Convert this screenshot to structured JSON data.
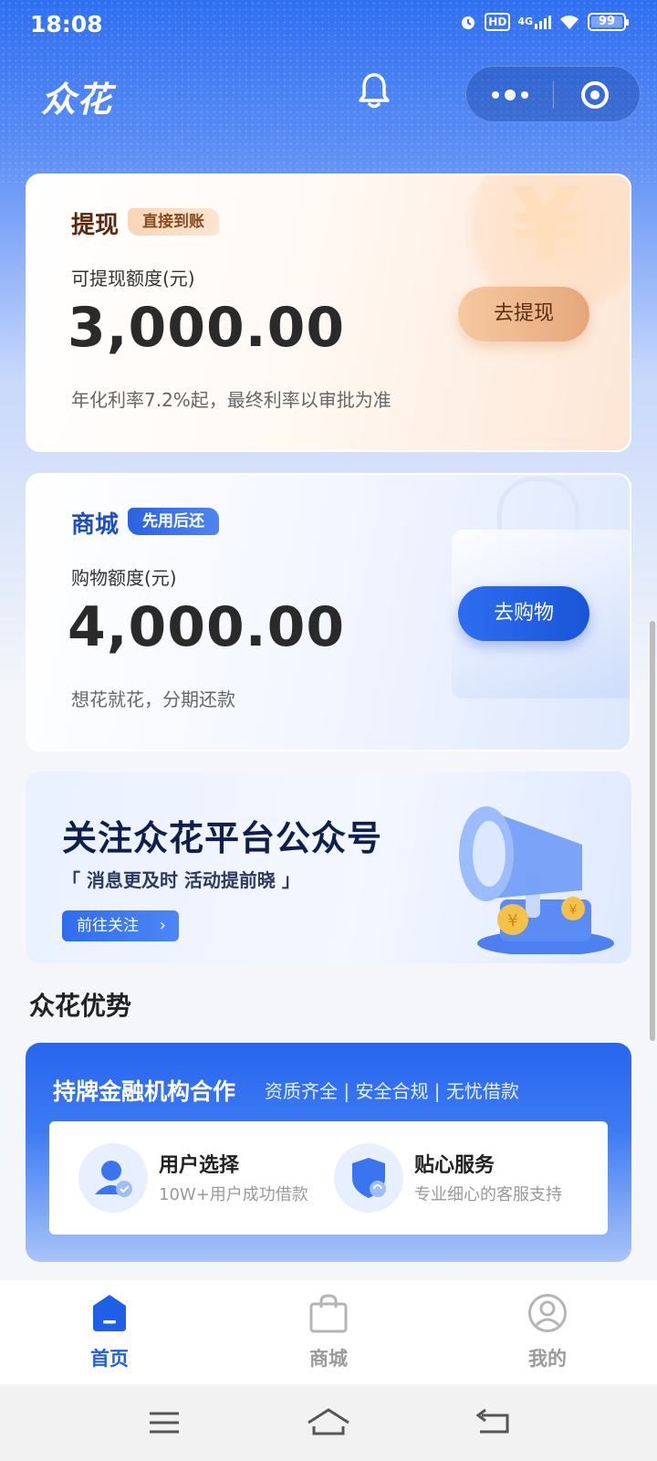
{
  "status_bar": {
    "time": "18:08",
    "hd": "HD",
    "network": "4G",
    "battery": "99"
  },
  "header": {
    "logo": "众花",
    "icons": [
      "bell-icon",
      "more-icon",
      "target-icon"
    ]
  },
  "withdraw_card": {
    "title": "提现",
    "tag": "直接到账",
    "label": "可提现额度(元)",
    "amount": "3,000.00",
    "note": "年化利率7.2%起，最终利率以审批为准",
    "button": "去提现"
  },
  "mall_card": {
    "title": "商城",
    "tag": "先用后还",
    "label": "购物额度(元)",
    "amount": "4,000.00",
    "note": "想花就花，分期还款",
    "button": "去购物"
  },
  "banner": {
    "title": "关注众花平台公众号",
    "subtitle": "「 消息更及时 活动提前晓 」",
    "button": "前往关注"
  },
  "advantages": {
    "section_title": "众花优势",
    "title": "持牌金融机构合作",
    "subtitle": "资质齐全 | 安全合规 | 无忧借款",
    "features": [
      {
        "title": "用户选择",
        "desc": "10W+用户成功借款",
        "icon": "user-check-icon"
      },
      {
        "title": "贴心服务",
        "desc": "专业细心的客服支持",
        "icon": "shield-service-icon"
      }
    ]
  },
  "tabbar": {
    "items": [
      {
        "label": "首页",
        "icon": "home-icon",
        "active": true
      },
      {
        "label": "商城",
        "icon": "shopping-bag-icon",
        "active": false
      },
      {
        "label": "我的",
        "icon": "profile-icon",
        "active": false
      }
    ]
  },
  "colors": {
    "primary": "#2f6df0",
    "accent_orange": "#e6a77a",
    "tab_active": "#1f5fe6",
    "tab_inactive": "#9a9a9a"
  }
}
